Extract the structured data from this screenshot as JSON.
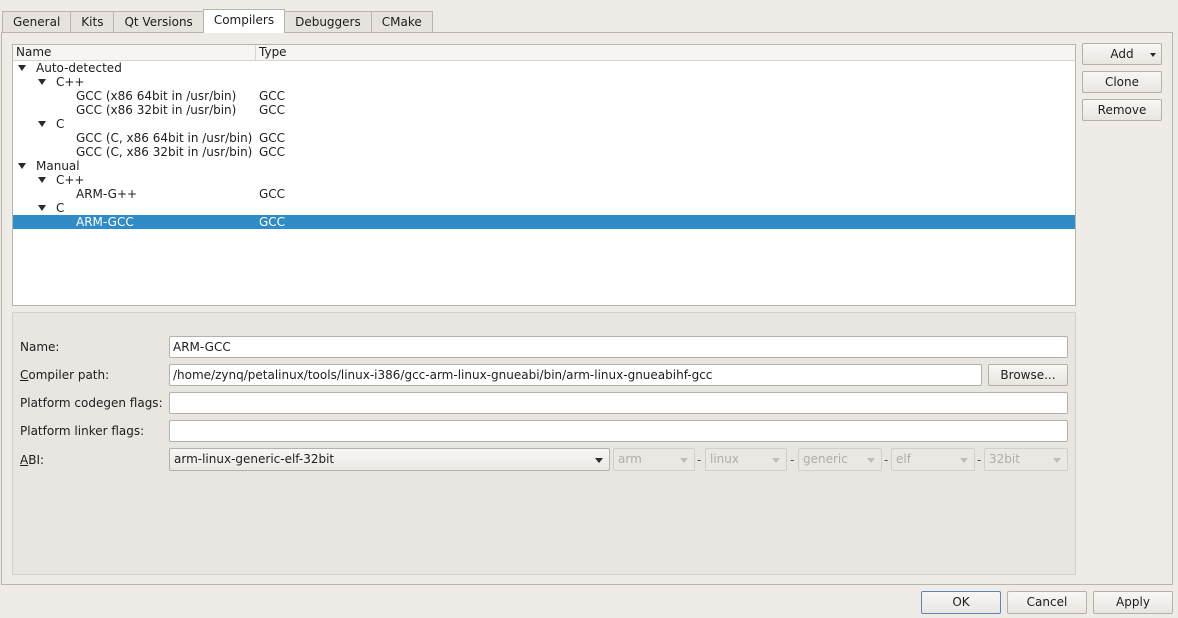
{
  "tabs": [
    "General",
    "Kits",
    "Qt Versions",
    "Compilers",
    "Debuggers",
    "CMake"
  ],
  "tree": {
    "columns": {
      "name": "Name",
      "type": "Type"
    },
    "rows": [
      {
        "name": "Auto-detected",
        "type": "",
        "level": 0,
        "expanded": true,
        "selected": false
      },
      {
        "name": "C++",
        "type": "",
        "level": 1,
        "expanded": true,
        "selected": false
      },
      {
        "name": "GCC (x86 64bit in /usr/bin)",
        "type": "GCC",
        "level": 2,
        "selected": false
      },
      {
        "name": "GCC (x86 32bit in /usr/bin)",
        "type": "GCC",
        "level": 2,
        "selected": false
      },
      {
        "name": "C",
        "type": "",
        "level": 1,
        "expanded": true,
        "selected": false
      },
      {
        "name": "GCC (C, x86 64bit in /usr/bin)",
        "type": "GCC",
        "level": 2,
        "selected": false
      },
      {
        "name": "GCC (C, x86 32bit in /usr/bin)",
        "type": "GCC",
        "level": 2,
        "selected": false
      },
      {
        "name": "Manual",
        "type": "",
        "level": 0,
        "expanded": true,
        "selected": false
      },
      {
        "name": "C++",
        "type": "",
        "level": 1,
        "expanded": true,
        "selected": false
      },
      {
        "name": "ARM-G++",
        "type": "GCC",
        "level": 2,
        "selected": false
      },
      {
        "name": "C",
        "type": "",
        "level": 1,
        "expanded": true,
        "selected": false
      },
      {
        "name": "ARM-GCC",
        "type": "GCC",
        "level": 2,
        "selected": true
      }
    ]
  },
  "side_buttons": {
    "add": "Add",
    "clone": "Clone",
    "remove": "Remove"
  },
  "details": {
    "name_label": "Name:",
    "name_value": "ARM-GCC",
    "compiler_path_label_first": "C",
    "compiler_path_label_rest": "ompiler path:",
    "compiler_path_value": "/home/zynq/petalinux/tools/linux-i386/gcc-arm-linux-gnueabi/bin/arm-linux-gnueabihf-gcc",
    "browse_label": "Browse...",
    "codegen_label": "Platform codegen flags:",
    "codegen_value": "",
    "linker_label": "Platform linker flags:",
    "linker_value": "",
    "abi_label_first": "A",
    "abi_label_rest": "BI:",
    "abi_value": "arm-linux-generic-elf-32bit",
    "abi_parts": [
      "arm",
      "linux",
      "generic",
      "elf",
      "32bit"
    ],
    "abi_separator": "-"
  },
  "dialog_buttons": {
    "ok": "OK",
    "cancel": "Cancel",
    "apply": "Apply"
  },
  "colors": {
    "selection": "#308cc6",
    "window_bg": "#efebe7"
  }
}
